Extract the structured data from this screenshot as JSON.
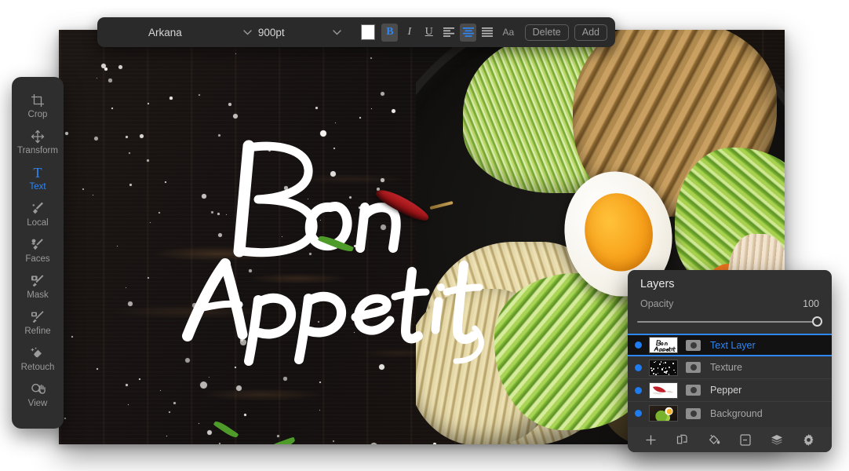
{
  "toolbar": {
    "font_name": "Arkana",
    "font_size": "900pt",
    "color_swatch": "#ffffff",
    "bold_label": "B",
    "italic_label": "I",
    "underline_label": "U",
    "case_label": "Aa",
    "delete_label": "Delete",
    "add_label": "Add",
    "align_left_name": "align-left",
    "align_center_name": "align-center",
    "align_justify_name": "align-justify",
    "active_style": "bold",
    "active_align": "center",
    "accent": "#2f86f5"
  },
  "sidebar": {
    "items": [
      {
        "label": "Crop",
        "icon": "crop-icon",
        "active": false
      },
      {
        "label": "Transform",
        "icon": "transform-icon",
        "active": false
      },
      {
        "label": "Text",
        "icon": "text-icon",
        "active": true
      },
      {
        "label": "Local",
        "icon": "local-icon",
        "active": false
      },
      {
        "label": "Faces",
        "icon": "faces-icon",
        "active": false
      },
      {
        "label": "Mask",
        "icon": "mask-icon",
        "active": false
      },
      {
        "label": "Refine",
        "icon": "refine-icon",
        "active": false
      },
      {
        "label": "Retouch",
        "icon": "retouch-icon",
        "active": false
      },
      {
        "label": "View",
        "icon": "view-icon",
        "active": false
      }
    ]
  },
  "canvas": {
    "headline_line1": "Bon",
    "headline_line2": "Appetit",
    "headline_color": "#ffffff"
  },
  "layers_panel": {
    "title": "Layers",
    "opacity_label": "Opacity",
    "opacity_value": "100",
    "opacity_percent": 100,
    "layers": [
      {
        "name": "Text Layer",
        "selected": true,
        "visible": true,
        "thumb": "text-thumb"
      },
      {
        "name": "Texture",
        "selected": false,
        "visible": true,
        "thumb": "texture-thumb"
      },
      {
        "name": "Pepper",
        "selected": false,
        "visible": true,
        "thumb": "pepper-thumb"
      },
      {
        "name": "Background",
        "selected": false,
        "visible": true,
        "thumb": "background-thumb"
      }
    ],
    "footer_icons": [
      "add-layer-icon",
      "duplicate-layer-icon",
      "fill-bucket-icon",
      "layer-mask-icon",
      "merge-layers-icon",
      "settings-gear-icon"
    ]
  }
}
